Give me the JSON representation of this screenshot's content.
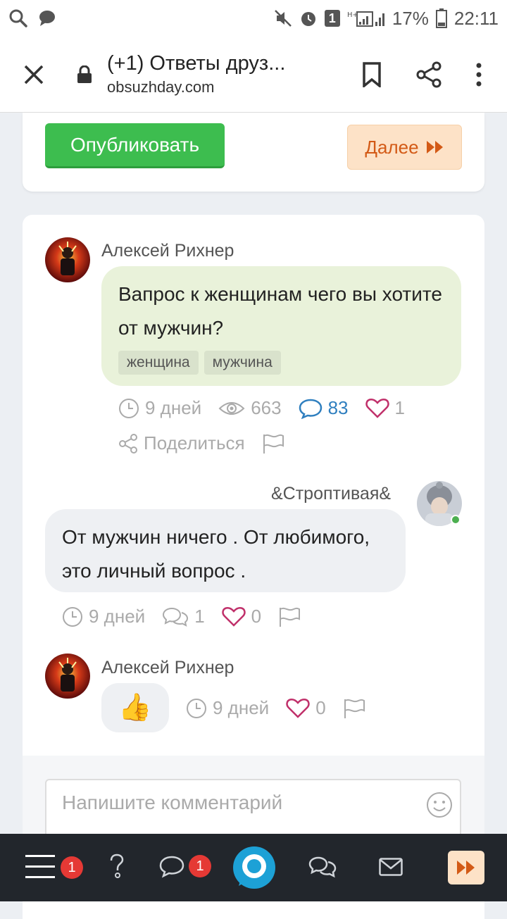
{
  "statusbar": {
    "sim_badge": "1",
    "battery": "17%",
    "time": "22:11"
  },
  "browser": {
    "title": "(+1) Ответы друз...",
    "url": "obsuzhday.com"
  },
  "actions": {
    "publish_label": "Опубликовать",
    "next_label": "Далее"
  },
  "question": {
    "author": "Алексей Рихнер",
    "text": "Вапрос к женщинам чего вы хотите от мужчин?",
    "tags": [
      "женщина",
      "мужчина"
    ],
    "time": "9 дней",
    "views": "663",
    "comments": "83",
    "likes": "1",
    "share_label": "Поделиться"
  },
  "reply": {
    "author": "&Строптивая&",
    "text": "От мужчин ничего . От любимого, это личный вопрос .",
    "time": "9 дней",
    "comments": "1",
    "likes": "0"
  },
  "reply2": {
    "author": "Алексей Рихнер",
    "emoji": "👍",
    "time": "9 дней",
    "likes": "0"
  },
  "comment_input": {
    "placeholder": "Напишите комментарий"
  },
  "bottomnav": {
    "menu_badge": "1",
    "messages_badge": "1"
  },
  "colors": {
    "accent_green": "#3dbd4f",
    "accent_orange": "#d35a16",
    "like_pink": "#c0306a",
    "comment_blue": "#2f7fbf"
  }
}
